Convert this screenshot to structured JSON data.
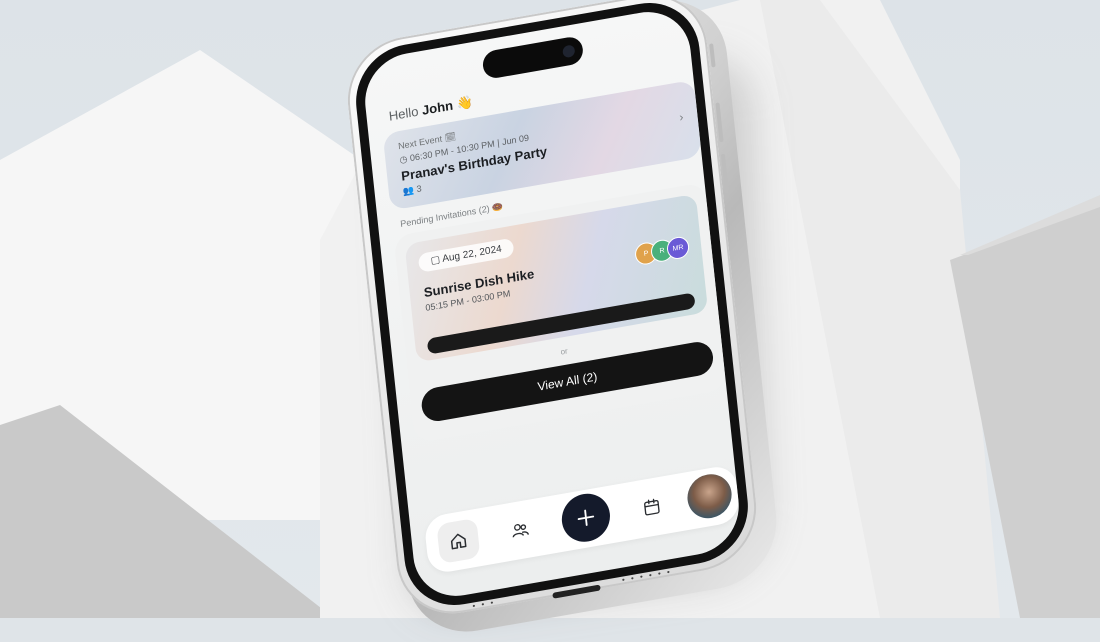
{
  "greeting": {
    "prefix": "Hello",
    "name": "John",
    "emoji": "👋"
  },
  "next_event": {
    "label": "Next Event 🗓",
    "time": "◷ 06:30 PM - 10:30 PM | Jun 09",
    "title": "Pranav's Birthday Party",
    "count": "👥 3"
  },
  "pending": {
    "label": "Pending Invitations (2) 🍩",
    "invite": {
      "date": "Aug 22, 2024",
      "title": "Sunrise Dish Hike",
      "time": "05:15 PM - 03:00 PM",
      "avatars": [
        "P",
        "R",
        "MR"
      ]
    },
    "or_text": "or",
    "view_all_label": "View All (2)"
  },
  "colors": {
    "accent": "#141a2b",
    "button_dark": "#141414"
  },
  "tabbar": {
    "items": [
      "home-icon",
      "friends-icon",
      "plus-icon",
      "calendar-icon",
      "profile-avatar"
    ]
  }
}
